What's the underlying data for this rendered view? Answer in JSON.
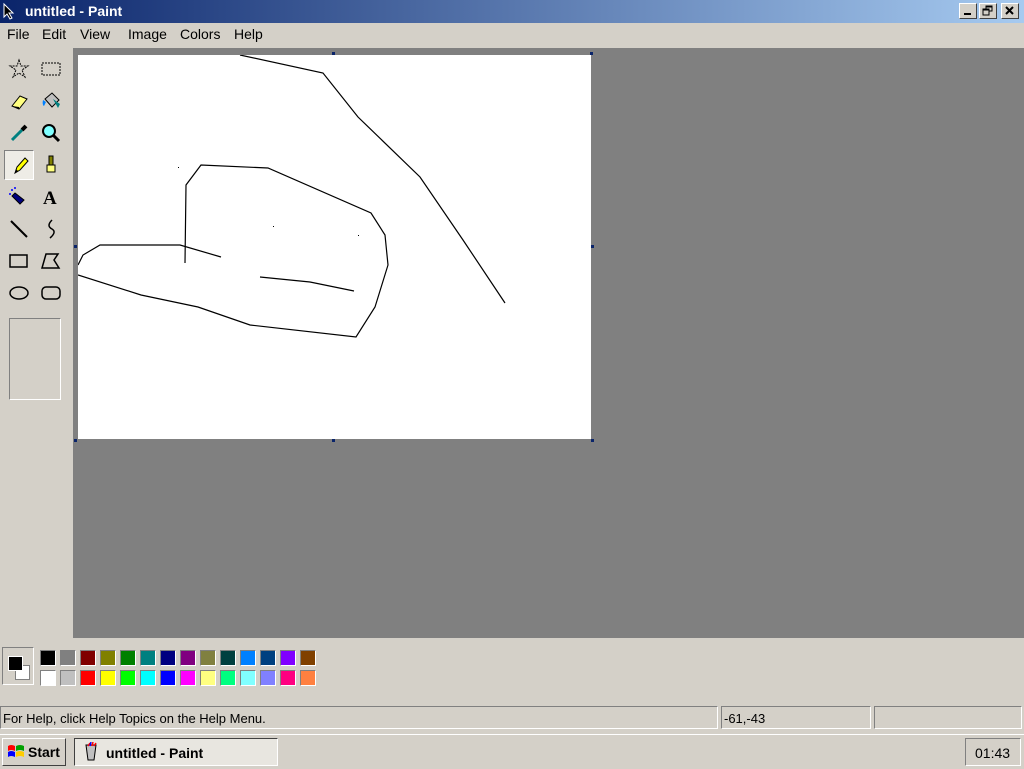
{
  "window": {
    "title": "untitled - Paint",
    "controls": [
      "minimize-icon",
      "restore-icon",
      "close-icon"
    ]
  },
  "menu": {
    "items": [
      "File",
      "Edit",
      "View",
      "Image",
      "Colors",
      "Help"
    ]
  },
  "toolbox": {
    "tools": [
      {
        "name": "free-form-select",
        "icon": "star-select-icon"
      },
      {
        "name": "select",
        "icon": "rect-select-icon"
      },
      {
        "name": "eraser",
        "icon": "eraser-icon"
      },
      {
        "name": "fill",
        "icon": "paint-bucket-icon"
      },
      {
        "name": "pick-color",
        "icon": "eyedropper-icon"
      },
      {
        "name": "magnifier",
        "icon": "magnifier-icon"
      },
      {
        "name": "pencil",
        "icon": "pencil-icon",
        "active": true
      },
      {
        "name": "brush",
        "icon": "brush-icon"
      },
      {
        "name": "airbrush",
        "icon": "airbrush-icon"
      },
      {
        "name": "text",
        "icon": "text-icon",
        "glyph": "A"
      },
      {
        "name": "line",
        "icon": "line-icon"
      },
      {
        "name": "curve",
        "icon": "curve-icon"
      },
      {
        "name": "rectangle",
        "icon": "rectangle-icon"
      },
      {
        "name": "polygon",
        "icon": "polygon-icon"
      },
      {
        "name": "ellipse",
        "icon": "ellipse-icon"
      },
      {
        "name": "rounded-rectangle",
        "icon": "rounded-rectangle-icon"
      }
    ]
  },
  "palette": {
    "foreground": "#000000",
    "background": "#ffffff",
    "colors_top": [
      "#000000",
      "#808080",
      "#800000",
      "#808000",
      "#008000",
      "#008080",
      "#000080",
      "#800080",
      "#808040",
      "#004040",
      "#0080ff",
      "#004080",
      "#8000ff",
      "#804000"
    ],
    "colors_bottom": [
      "#ffffff",
      "#c0c0c0",
      "#ff0000",
      "#ffff00",
      "#00ff00",
      "#00ffff",
      "#0000ff",
      "#ff00ff",
      "#ffff80",
      "#00ff80",
      "#80ffff",
      "#8080ff",
      "#ff0080",
      "#ff8040"
    ]
  },
  "status": {
    "help_text": "For Help, click Help Topics on the Help Menu.",
    "coordinates": "-61,-43",
    "size": ""
  },
  "taskbar": {
    "start_label": "Start",
    "task_label": "untitled - Paint",
    "clock": "01:43"
  }
}
